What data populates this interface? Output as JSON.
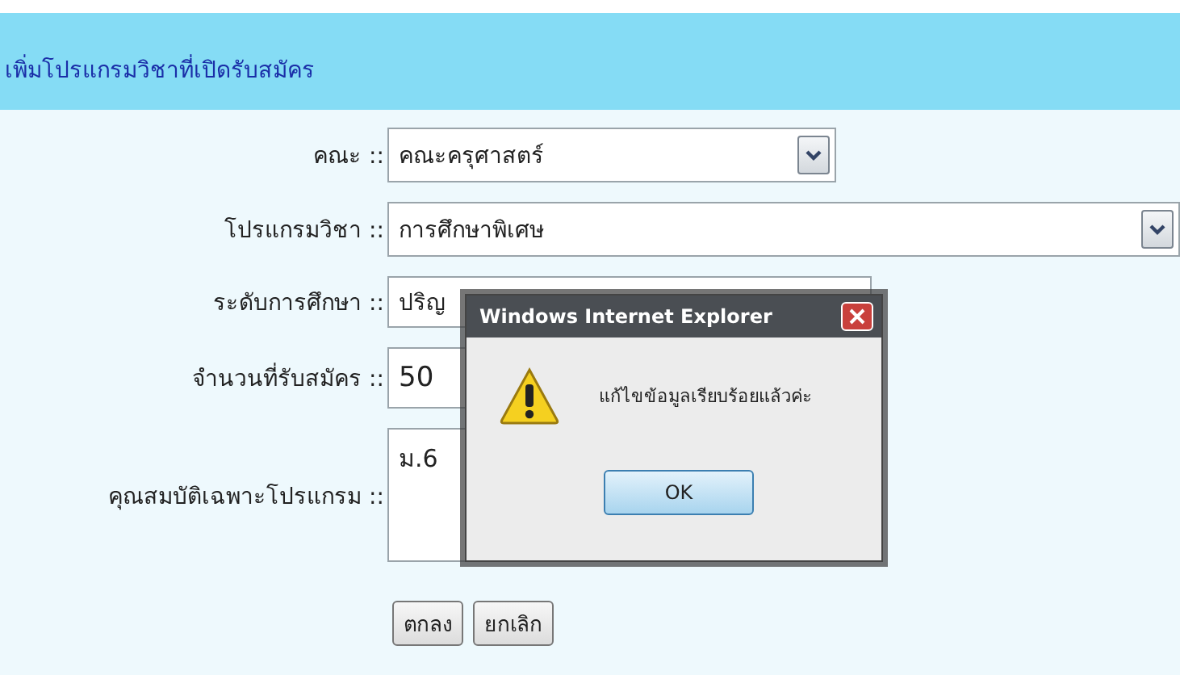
{
  "page": {
    "title": "เพิ่มโปรแกรมวิชาที่เปิดรับสมัคร"
  },
  "form": {
    "fields": [
      {
        "label": "คณะ ::",
        "kind": "select",
        "value": "คณะครุศาสตร์"
      },
      {
        "label": "โปรแกรมวิชา ::",
        "kind": "select",
        "value": "การศึกษาพิเศษ"
      },
      {
        "label": "ระดับการศึกษา ::",
        "kind": "text",
        "value": "ปริญ"
      },
      {
        "label": "จำนวนที่รับสมัคร ::",
        "kind": "text",
        "value": "50"
      },
      {
        "label": "คุณสมบัติเฉพาะโปรแกรม ::",
        "kind": "textarea",
        "value": "ม.6"
      }
    ],
    "buttons": [
      "ตกลง",
      "ยกเลิก"
    ]
  },
  "dialog": {
    "title": "Windows Internet Explorer",
    "message": "แก้ไขข้อมูลเรียบร้อยแล้วค่ะ",
    "button": "OK"
  }
}
